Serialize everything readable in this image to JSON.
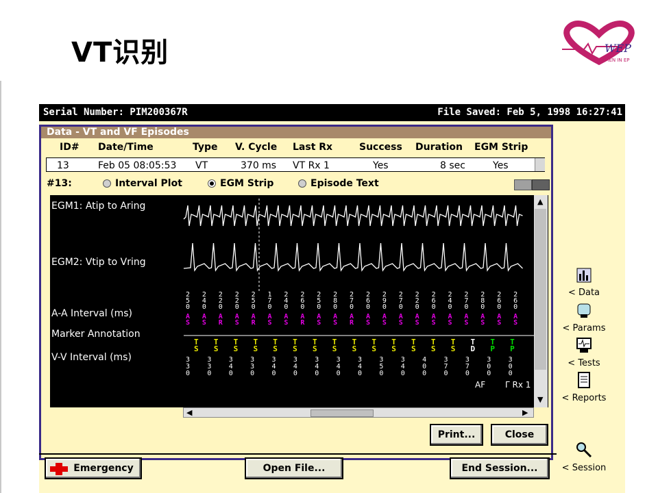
{
  "slide": {
    "title": "VT识别",
    "logo_caption": "WOMEN IN EP",
    "logo_text": "WEP"
  },
  "app": {
    "serial": "Serial Number: PIM200367R",
    "file_saved": "File Saved: Feb 5, 1998 16:27:41",
    "panel_title": "Data - VT and VF Episodes",
    "columns": [
      "ID#",
      "Date/Time",
      "Type",
      "V. Cycle",
      "Last Rx",
      "Success",
      "Duration",
      "EGM Strip"
    ],
    "episode": {
      "id": "13",
      "datetime": "Feb 05 08:05:53",
      "type": "VT",
      "vcycle": "370 ms",
      "lastrx": "VT Rx 1",
      "success": "Yes",
      "duration": "8 sec",
      "egm": "Yes"
    },
    "episode_label": "#13:",
    "views": [
      {
        "label": "Interval Plot",
        "selected": false
      },
      {
        "label": "EGM Strip",
        "selected": true
      },
      {
        "label": "Episode Text",
        "selected": false
      }
    ],
    "strip": {
      "egm1_label": "EGM1: Atip to Aring",
      "egm2_label": "EGM2: Vtip to Vring",
      "aa_label": "A-A Interval (ms)",
      "marker_label": "Marker Annotation",
      "vv_label": "V-V Interval (ms)",
      "aa_intervals": [
        "250",
        "240",
        "220",
        "220",
        "250",
        "170",
        "240",
        "260",
        "250",
        "280",
        "270",
        "260",
        "290",
        "270",
        "220",
        "260",
        "240",
        "270",
        "280",
        "260",
        "260"
      ],
      "atrial_markers": [
        "AS",
        "AS",
        "AR",
        "AS",
        "AR",
        "AS",
        "AS",
        "AR",
        "AS",
        "AS",
        "AR",
        "AS",
        "AS",
        "AS",
        "AS",
        "AS",
        "AS",
        "AS",
        "AS",
        "AS",
        "AS"
      ],
      "vent_markers": [
        "TS",
        "TS",
        "TS",
        "TS",
        "TS",
        "TS",
        "TS",
        "TS",
        "TS",
        "TS",
        "TS",
        "TS",
        "TS",
        "TS",
        "TD",
        "TP",
        "TP"
      ],
      "vv_intervals": [
        "330",
        "330",
        "340",
        "330",
        "340",
        "340",
        "340",
        "340",
        "340",
        "350",
        "340",
        "400",
        "370",
        "370",
        "300",
        "300"
      ],
      "annot_af": "AF",
      "annot_rx": "Γ Rx 1"
    },
    "buttons": {
      "print": "Print...",
      "close": "Close",
      "emergency": "Emergency",
      "open_file": "Open File...",
      "end_session": "End Session..."
    },
    "side_nav": [
      "< Data",
      "< Params",
      "< Tests",
      "< Reports",
      "< Session"
    ],
    "colors": {
      "screen_bg": "#fff8c8",
      "marker_magenta": "#e000e0",
      "marker_yellow": "#e8e800",
      "marker_green": "#00e000",
      "panel_border": "#3a2a88"
    }
  }
}
